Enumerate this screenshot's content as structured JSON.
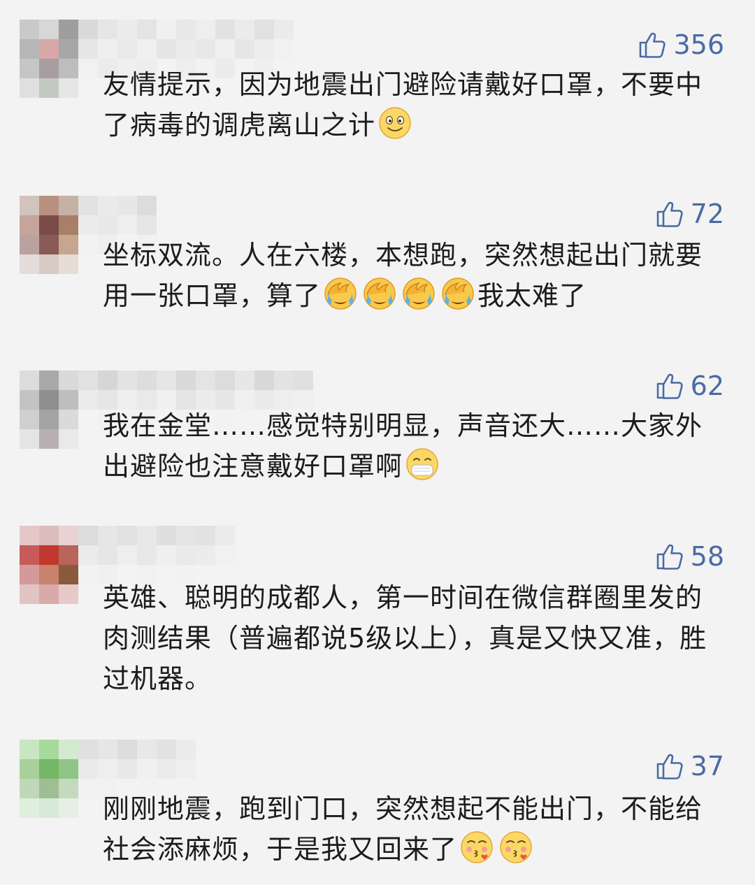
{
  "comments": [
    {
      "likes": "356",
      "text": "友情提示，因为地震出门避险请戴好口罩，不要中了病毒的调虎离山之计",
      "emojis": [
        "smile"
      ],
      "avatar": [
        "#c9c9c9",
        "#d7d7d7",
        "#9e9e9e",
        "#b7b7b7",
        "#d8a8a8",
        "#a7a7a7",
        "#c6c6c6",
        "#a89ea0",
        "#bdbdbd",
        "#e0e0e0",
        "#c4c8c3",
        "#e6e6e6"
      ],
      "name_blur": [
        [
          "#d9d9d9",
          "#e6e6e6",
          "#ececec",
          "#e4e4e4",
          "#f0f0f0",
          "#e8e8e8",
          "#eeeeee",
          "#e2e2e2",
          "#ebebeb",
          "#e1e1e1",
          "#ebebeb"
        ],
        [
          "#e7e7e7",
          "#efefef",
          "#e9e9e9",
          "#f0f0f0",
          "#e5e5e5",
          "#ececec",
          "#e8e8e8",
          "#f0f0f0",
          "#e6e6e6",
          "#ededed",
          "#f1f1f1"
        ],
        [
          "#f1f1f1",
          "#ebebeb",
          "#efefef",
          "#ededed",
          "#f3f3f3",
          "#eeeeee",
          "#f2f2f2",
          "#ececec",
          "#f3f3f3",
          "#efefef",
          "#f3f3f3"
        ]
      ]
    },
    {
      "likes": "72",
      "text": "坐标双流。人在六楼，本想跑，突然想起出门就要用一张口罩，算了",
      "tail": "我太难了",
      "emojis": [
        "facepalm-cry",
        "facepalm-cry",
        "facepalm-cry",
        "facepalm-cry"
      ],
      "avatar": [
        "#d2c3bc",
        "#b89080",
        "#c6b1a6",
        "#c4a49b",
        "#7a4b48",
        "#a88068",
        "#b9a2a2",
        "#8a5a57",
        "#c6a68f",
        "#e5dbd8",
        "#d8cbc6",
        "#e6dcd6"
      ],
      "name_blur": [
        [
          "#e2e2e2",
          "#eaeaea",
          "#e7e7e7",
          "#dcdcdc"
        ],
        [
          "#ececec",
          "#e8e8e8",
          "#efefef",
          "#e6e6e6"
        ],
        [
          "#f2f2f2",
          "#efefef",
          "#f3f3f3",
          "#f1f1f1"
        ]
      ]
    },
    {
      "likes": "62",
      "text": "我在金堂……感觉特别明显，声音还大……大家外出避险也注意戴好口罩啊",
      "emojis": [
        "mask"
      ],
      "avatar": [
        "#dcdcdc",
        "#a9a9a9",
        "#d9d9d9",
        "#c3c3c3",
        "#8f8f8f",
        "#bebebe",
        "#cfcfcf",
        "#a4a4a4",
        "#dadada",
        "#e4e4e4",
        "#b9b1b1",
        "#e9e9e9"
      ],
      "name_blur": [
        [
          "#e1e1e1",
          "#d6d6d6",
          "#e3e3e3",
          "#dddddd",
          "#e6e6e6",
          "#d9d9d9",
          "#e4e4e4",
          "#dcdcdc",
          "#e7e7e7",
          "#d8d8d8",
          "#e3e3e3",
          "#e0e0e0"
        ],
        [
          "#ebebeb",
          "#e6e6e6",
          "#eeeeee",
          "#e9e9e9",
          "#f0f0f0",
          "#e5e5e5",
          "#ececec",
          "#e7e7e7",
          "#f0f0f0",
          "#eaeaea",
          "#eeeeee",
          "#f0f0f0"
        ],
        [
          "#f3f3f3",
          "#f1f1f1",
          "#f3f3f3",
          "#f2f2f2",
          "#f3f3f3",
          "#f1f1f1",
          "#f3f3f3",
          "#f2f2f2",
          "#f3f3f3",
          "#f3f3f3",
          "#f3f3f3",
          "#f3f3f3"
        ]
      ]
    },
    {
      "likes": "58",
      "text": "英雄、聪明的成都人，第一时间在微信群圈里发的肉测结果（普遍都说5级以上），真是又快又准，胜过机器。",
      "emojis": [],
      "avatar": [
        "#e6c7c7",
        "#dcbcbc",
        "#e9d2d2",
        "#c85a5a",
        "#c0382e",
        "#b9655a",
        "#d49a9a",
        "#c9826c",
        "#8a5a3c",
        "#e2c3c3",
        "#d8aaa8",
        "#e8c9c9"
      ],
      "name_blur": [
        [
          "#dcdcdc",
          "#e6e6e6",
          "#e1e1e1",
          "#e8e8e8",
          "#dfdfdf",
          "#e5e5e5",
          "#e2e2e2",
          "#ebebeb"
        ],
        [
          "#ebebeb",
          "#e6e6e6",
          "#eeeeee",
          "#e8e8e8",
          "#efefef",
          "#eaeaea",
          "#ececec",
          "#f1f1f1"
        ],
        [
          "#f2f2f2",
          "#f0f0f0",
          "#f3f3f3",
          "#f1f1f1",
          "#f3f3f3",
          "#f2f2f2",
          "#f3f3f3",
          "#f3f3f3"
        ]
      ]
    },
    {
      "likes": "37",
      "text": "刚刚地震，跑到门口，突然想起不能出门，不能给社会添麻烦，于是我又回来了",
      "emojis": [
        "kiss",
        "kiss"
      ],
      "avatar": [
        "#c9e6c2",
        "#a8d99c",
        "#d3ead0",
        "#a9cf9b",
        "#74b766",
        "#8fc584",
        "#bfd9b8",
        "#9ebf95",
        "#c3dabd",
        "#dfeedd",
        "#d8e8d6",
        "#e6efe4"
      ],
      "name_blur": [
        [
          "#e0e0e0",
          "#e6e6e6",
          "#dddddd",
          "#e8e8e8",
          "#e2e2e2",
          "#ebebeb"
        ],
        [
          "#eaeaea",
          "#eeeeee",
          "#e8e8e8",
          "#f0f0f0",
          "#ebebeb",
          "#efefef"
        ],
        [
          "#f2f2f2",
          "#f1f1f1",
          "#f3f3f3",
          "#f2f2f2",
          "#f3f3f3",
          "#f3f3f3"
        ]
      ]
    }
  ],
  "colors": {
    "like": "#4a6aa4",
    "background": "#f3f3f3",
    "text": "#1c1c1c"
  },
  "icons": {
    "like": "thumbs-up-icon"
  }
}
